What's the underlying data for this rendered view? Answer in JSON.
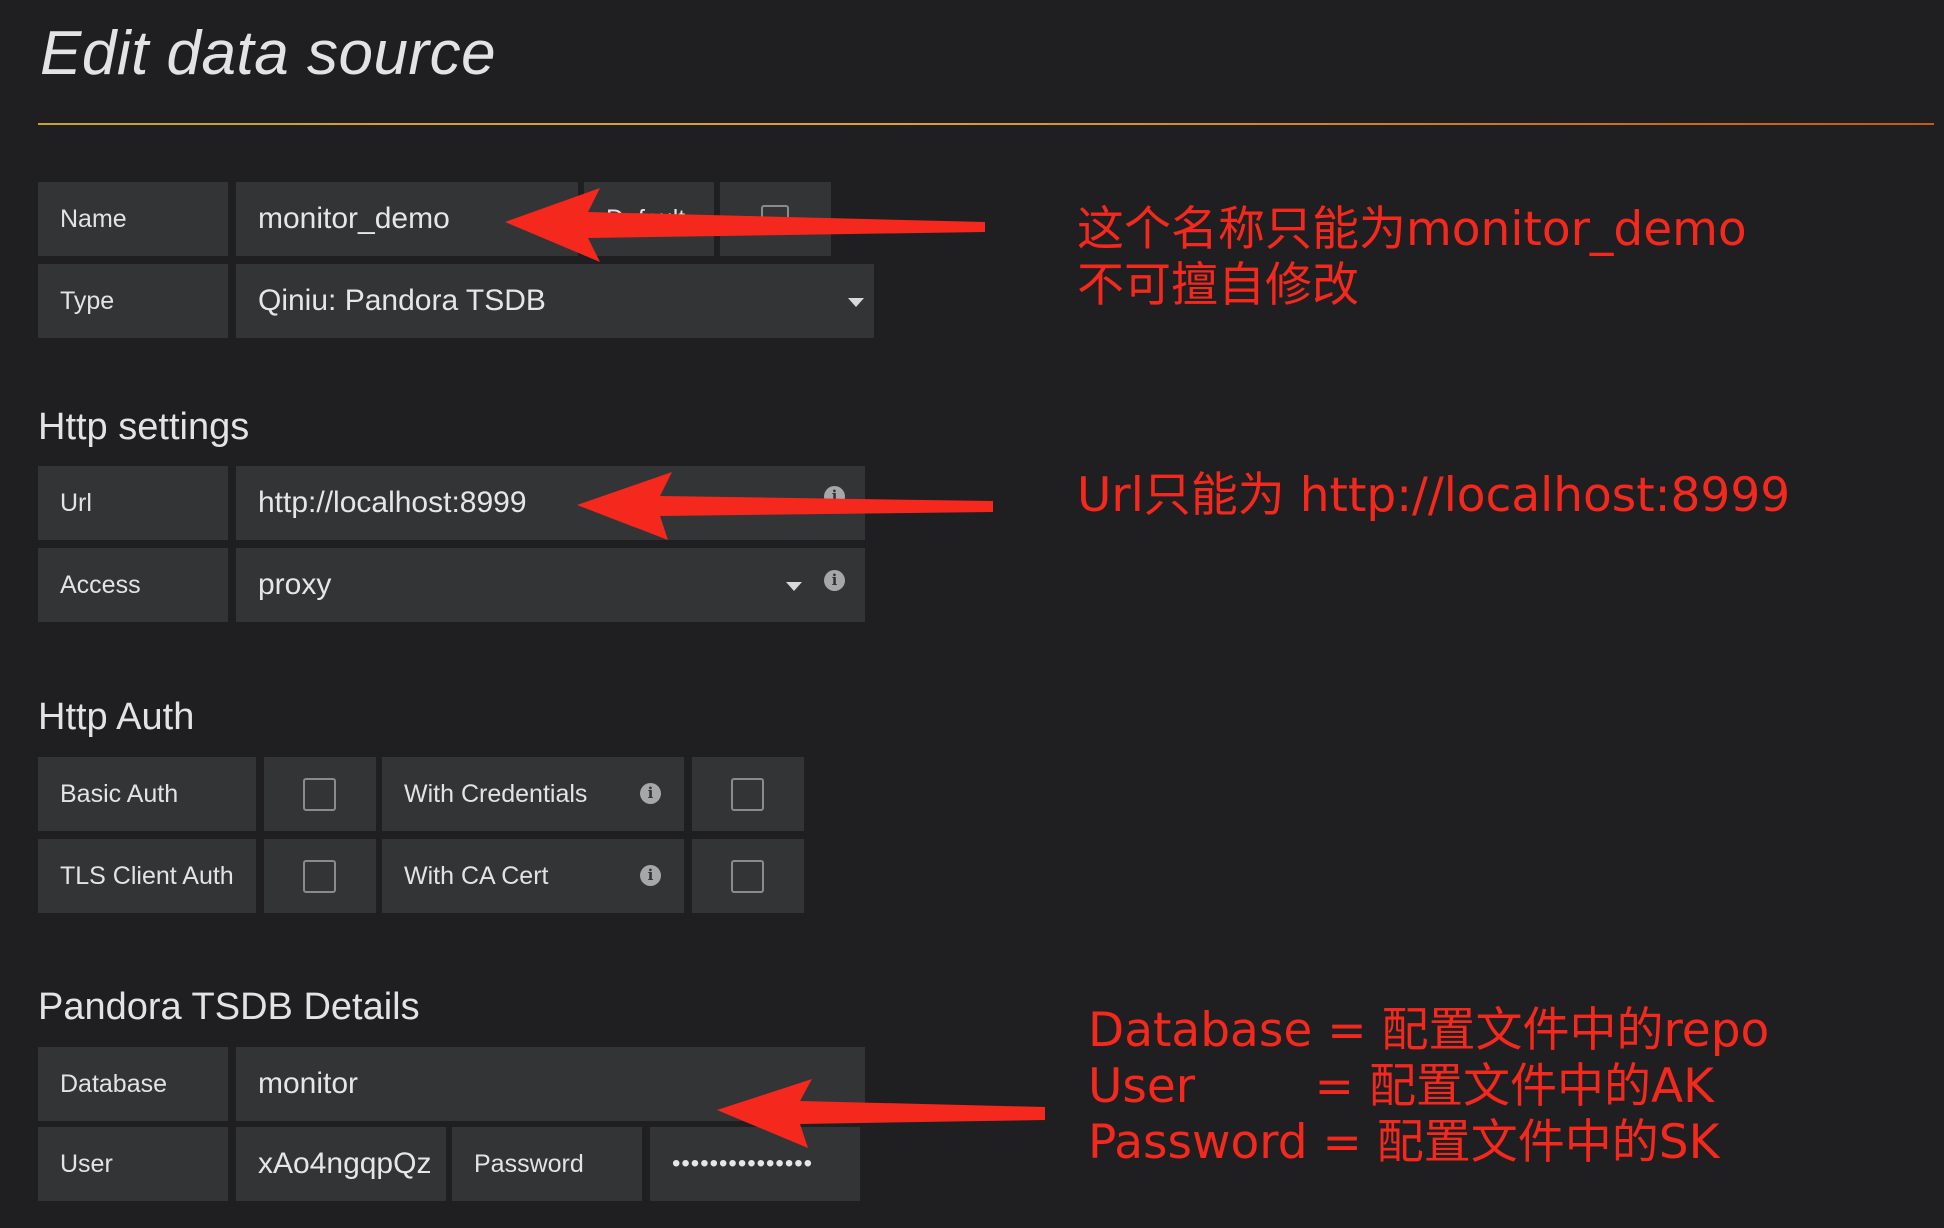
{
  "page": {
    "title": "Edit data source"
  },
  "general": {
    "name_label": "Name",
    "name_value": "monitor_demo",
    "default_label": "Default",
    "type_label": "Type",
    "type_value": "Qiniu: Pandora TSDB"
  },
  "http_settings": {
    "title": "Http settings",
    "url_label": "Url",
    "url_value": "http://localhost:8999",
    "access_label": "Access",
    "access_value": "proxy"
  },
  "http_auth": {
    "title": "Http Auth",
    "basic_auth_label": "Basic Auth",
    "with_credentials_label": "With Credentials",
    "tls_client_auth_label": "TLS Client Auth",
    "with_ca_cert_label": "With CA Cert"
  },
  "details": {
    "title": "Pandora TSDB Details",
    "database_label": "Database",
    "database_value": "monitor",
    "user_label": "User",
    "user_value": "xAo4ngqpQz",
    "password_label": "Password",
    "password_value": "•••••••••••••••"
  },
  "annotations": {
    "name_note": "这个名称只能为monitor_demo\n不可擅自修改",
    "url_note": "Url只能为 http://localhost:8999",
    "details_note": "Database = 配置文件中的repo\nUser        = 配置文件中的AK\nPassword = 配置文件中的SK",
    "color": "#f5281e"
  },
  "icons": [
    "info-icon",
    "caret-down-icon",
    "checkbox-icon",
    "annotation-arrow"
  ]
}
